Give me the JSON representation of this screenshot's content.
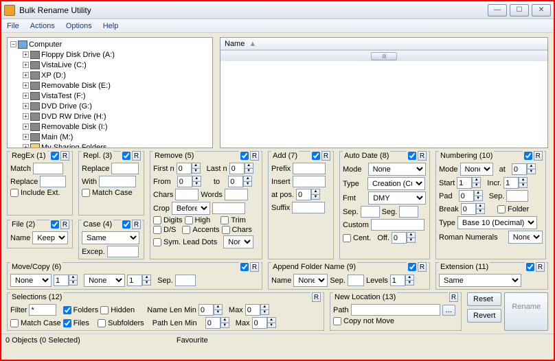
{
  "title": "Bulk Rename Utility",
  "menus": [
    "File",
    "Actions",
    "Options",
    "Help"
  ],
  "tree": {
    "root": "Computer",
    "nodes": [
      "Floppy Disk Drive (A:)",
      "VistaLive (C:)",
      "XP (D:)",
      "Removable Disk (E:)",
      "VistaTest (F:)",
      "DVD Drive (G:)",
      "DVD RW Drive (H:)",
      "Removable Disk (I:)",
      "Main (M:)",
      "My Sharing Folders"
    ]
  },
  "list": {
    "col": "Name"
  },
  "regex": {
    "t": "RegEx (1)",
    "match": "Match",
    "replace": "Replace",
    "inc": "Include Ext."
  },
  "file": {
    "t": "File (2)",
    "name": "Name",
    "opt": "Keep"
  },
  "repl": {
    "t": "Repl. (3)",
    "replace": "Replace",
    "with": "With",
    "mc": "Match Case"
  },
  "case": {
    "t": "Case (4)",
    "opt": "Same",
    "ex": "Excep."
  },
  "remove": {
    "t": "Remove (5)",
    "fn": "First n",
    "ln": "Last n",
    "from": "From",
    "to": "to",
    "chars": "Chars",
    "words": "Words",
    "crop": "Crop",
    "cropopt": "Before",
    "d": "Digits",
    "h": "High",
    "ds": "D/S",
    "ac": "Accents",
    "sym": "Sym.",
    "ld": "Lead Dots",
    "trim": "Trim",
    "ch2": "Chars",
    "non": "Non"
  },
  "add": {
    "t": "Add (7)",
    "prefix": "Prefix",
    "insert": "Insert",
    "atpos": "at pos.",
    "suffix": "Suffix"
  },
  "autodate": {
    "t": "Auto Date (8)",
    "mode": "Mode",
    "modev": "None",
    "type": "Type",
    "typev": "Creation (Curr",
    "fmt": "Fmt",
    "fmtv": "DMY",
    "sep": "Sep.",
    "seg": "Seg.",
    "custom": "Custom",
    "cent": "Cent.",
    "off": "Off."
  },
  "num": {
    "t": "Numbering (10)",
    "mode": "Mode",
    "modev": "None",
    "at": "at",
    "start": "Start",
    "incr": "Incr.",
    "pad": "Pad",
    "sep": "Sep.",
    "break": "Break",
    "folder": "Folder",
    "type": "Type",
    "typev": "Base 10 (Decimal)",
    "rn": "Roman Numerals",
    "rnv": "None"
  },
  "mc": {
    "t": "Move/Copy (6)",
    "none": "None",
    "sep": "Sep."
  },
  "afn": {
    "t": "Append Folder Name (9)",
    "name": "Name",
    "namev": "None",
    "sep": "Sep.",
    "lev": "Levels"
  },
  "ext": {
    "t": "Extension (11)",
    "opt": "Same"
  },
  "sel": {
    "t": "Selections (12)",
    "filter": "Filter",
    "fv": "*",
    "folders": "Folders",
    "hidden": "Hidden",
    "mc": "Match Case",
    "files": "Files",
    "sub": "Subfolders",
    "nlm": "Name Len Min",
    "plm": "Path Len Min",
    "max": "Max"
  },
  "nl": {
    "t": "New Location (13)",
    "path": "Path",
    "cnm": "Copy not Move"
  },
  "btns": {
    "reset": "Reset",
    "revert": "Revert",
    "rename": "Rename"
  },
  "status": {
    "obj": "0 Objects (0 Selected)",
    "fav": "Favourite"
  },
  "spv": {
    "z": "0",
    "o": "1"
  }
}
